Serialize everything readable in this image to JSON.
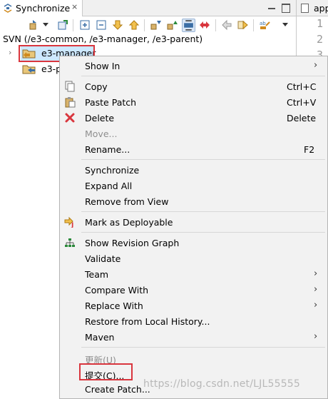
{
  "view": {
    "tab_title": "Synchronize",
    "close_glyph": "⨯",
    "svn_label": "SVN (/e3-common, /e3-manager, /e3-parent)"
  },
  "editor": {
    "tab_title": "app",
    "line_numbers": [
      "1",
      "2",
      "3"
    ]
  },
  "tree": {
    "items": [
      {
        "label": "e3-manager",
        "selected": true
      },
      {
        "label": "e3-p"
      }
    ]
  },
  "menu": {
    "items": [
      {
        "label": "Show In",
        "submenu": true
      },
      {
        "label": "Copy",
        "accel": "Ctrl+C",
        "icon": "copy-icon"
      },
      {
        "label": "Paste Patch",
        "accel": "Ctrl+V",
        "icon": "paste-icon"
      },
      {
        "label": "Delete",
        "accel": "Delete",
        "icon": "delete-icon"
      },
      {
        "label": "Move...",
        "disabled": true
      },
      {
        "label": "Rename...",
        "accel": "F2"
      },
      {
        "label": "Synchronize"
      },
      {
        "label": "Expand All"
      },
      {
        "label": "Remove from View"
      },
      {
        "label": "Mark as Deployable",
        "icon": "deploy-icon"
      },
      {
        "label": "Show Revision Graph",
        "icon": "revision-graph-icon"
      },
      {
        "label": "Validate"
      },
      {
        "label": "Team",
        "submenu": true
      },
      {
        "label": "Compare With",
        "submenu": true
      },
      {
        "label": "Replace With",
        "submenu": true
      },
      {
        "label": "Restore from Local History..."
      },
      {
        "label": "Maven",
        "submenu": true
      },
      {
        "label": "更新(U)",
        "disabled": true
      },
      {
        "label": "提交(C)..."
      },
      {
        "label": "Create Patch..."
      }
    ],
    "submenu_arrow": "›"
  },
  "watermark": "https://blog.csdn.net/LJL55555",
  "colors": {
    "highlight_box": "#d9363e",
    "selection": "#cde8ff",
    "menu_bg": "#f2f2f2"
  }
}
